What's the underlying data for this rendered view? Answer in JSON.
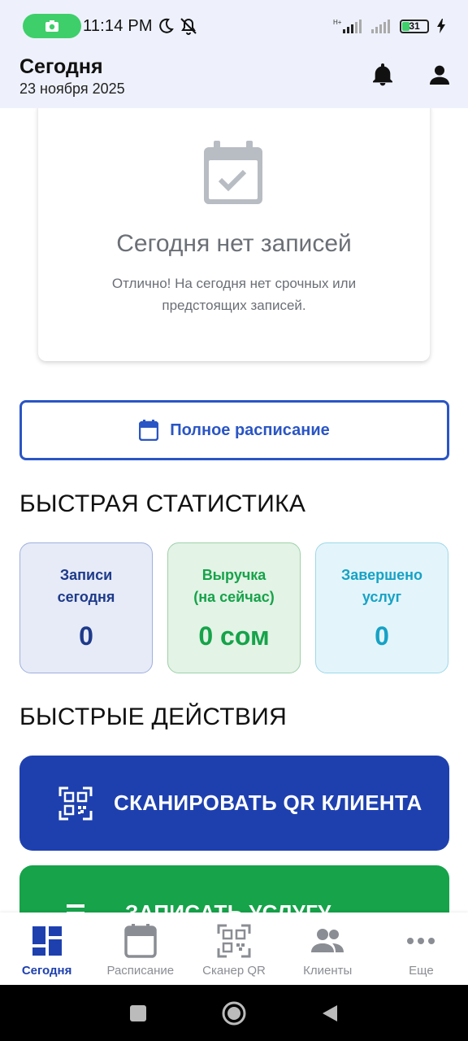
{
  "status_bar": {
    "time": "11:14 PM",
    "battery": "31",
    "icons": [
      "camera-icon",
      "moon-icon",
      "vibrate-off-icon",
      "signal-icon",
      "signal-icon",
      "battery-icon",
      "charging-icon"
    ]
  },
  "header": {
    "title": "Сегодня",
    "date": "23 ноября 2025",
    "icons": [
      "bell-icon",
      "user-icon"
    ]
  },
  "empty_state": {
    "title": "Сегодня нет записей",
    "text": "Отлично! На сегодня нет срочных или предстоящих записей."
  },
  "full_schedule_button": {
    "label": "Полное расписание"
  },
  "quick_stats": {
    "title": "БЫСТРАЯ СТАТИСТИКА",
    "cards": [
      {
        "label_line1": "Записи",
        "label_line2": "сегодня",
        "value": "0",
        "color": "#1e3a8a",
        "bg": "#e6ebf7",
        "border": "#9fb0de"
      },
      {
        "label_line1": "Выручка",
        "label_line2": "(на сейчас)",
        "value": "0 сом",
        "color": "#16a34a",
        "bg": "#e3f3e6",
        "border": "#9ed0a8"
      },
      {
        "label_line1": "Завершено",
        "label_line2": "услуг",
        "value": "0",
        "color": "#17a2c5",
        "bg": "#e3f5fb",
        "border": "#9ed8e8"
      }
    ]
  },
  "quick_actions": {
    "title": "БЫСТРЫЕ ДЕЙСТВИЯ",
    "items": [
      {
        "label": "СКАНИРОВАТЬ QR КЛИЕНТА",
        "color": "#1e40af"
      },
      {
        "label": "ЗАПИСАТЬ УСЛУГУ",
        "color": "#16a34a"
      }
    ]
  },
  "bottom_nav": {
    "items": [
      {
        "label": "Сегодня",
        "active": true
      },
      {
        "label": "Расписание",
        "active": false
      },
      {
        "label": "Сканер QR",
        "active": false
      },
      {
        "label": "Клиенты",
        "active": false
      },
      {
        "label": "Еще",
        "active": false
      }
    ]
  }
}
